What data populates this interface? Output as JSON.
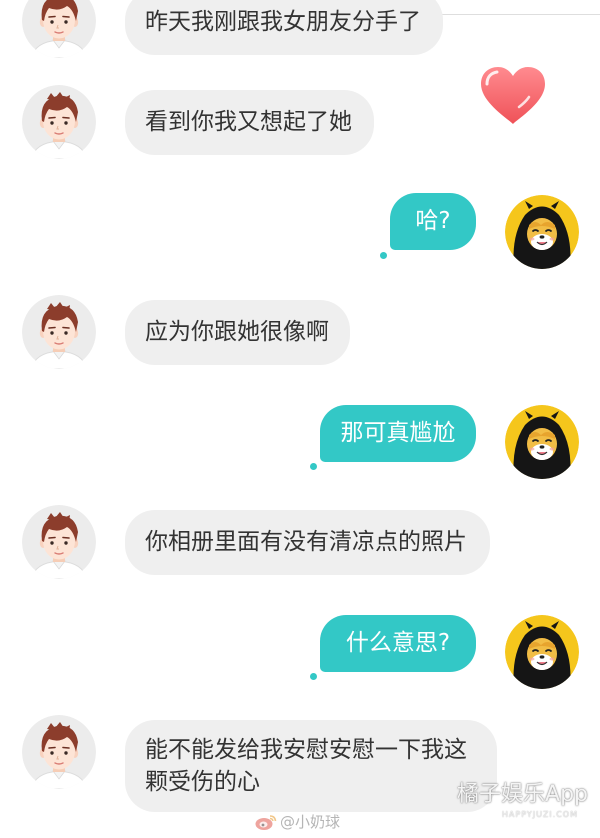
{
  "messages": [
    {
      "text": "昨天我刚跟我女朋友分手了"
    },
    {
      "text": "看到你我又想起了她"
    },
    {
      "text": "哈?"
    },
    {
      "text": "应为你跟她很像啊"
    },
    {
      "text": "那可真尴尬"
    },
    {
      "text": "你相册里面有没有清凉点的照片"
    },
    {
      "text": "什么意思?"
    },
    {
      "lines": [
        "能不能发给我安慰安慰一下我这",
        "颗受伤的心"
      ]
    }
  ],
  "icons": {
    "left_avatar": "male-cartoon-avatar-icon",
    "right_avatar": "hooded-dog-avatar-icon",
    "sticker": "heart-icon",
    "weibo": "weibo-logo-icon"
  },
  "watermark": {
    "brand": "橘子娱乐App",
    "site": "HAPPYJUZI.COM",
    "weibo_handle": "@小奶球"
  },
  "colors": {
    "left_bubble": "#efefef",
    "right_bubble": "#33c8c6",
    "left_text": "#333333",
    "right_text": "#ffffff",
    "heart": "#f2636a",
    "right_avatar_bg": "#f5c61c"
  }
}
